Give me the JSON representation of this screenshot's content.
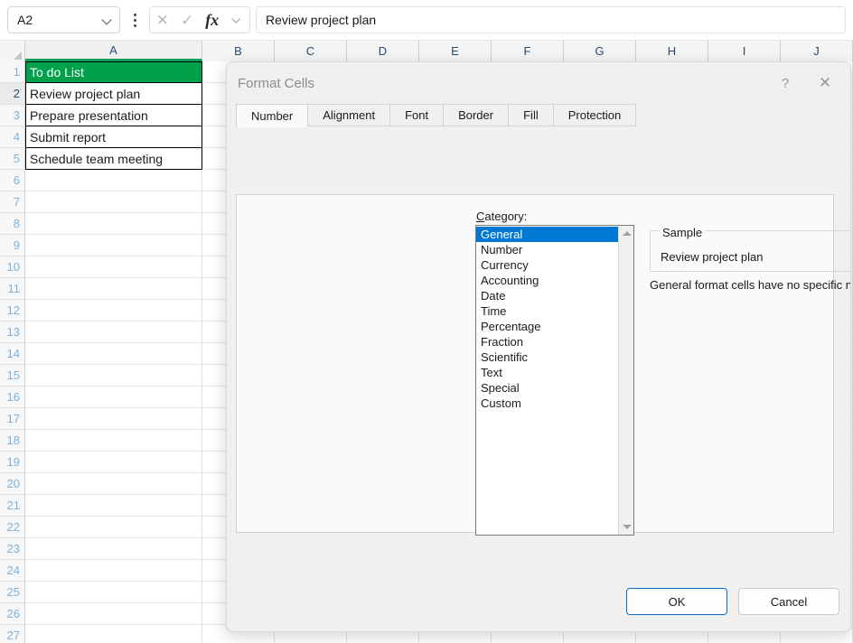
{
  "formula_bar": {
    "name_box_value": "A2",
    "name_box_icon": "chevron-down-icon",
    "menu_icon": "kebab-menu-icon",
    "cancel_icon": "✕",
    "confirm_icon": "✓",
    "function_icon": "fx",
    "function_dropdown_icon": "chevron-down-icon",
    "formula_value": "Review project plan"
  },
  "grid": {
    "column_headers": [
      "A",
      "B",
      "C",
      "D",
      "E",
      "F",
      "G",
      "H",
      "I",
      "J"
    ],
    "selected_column": "A",
    "selected_row": 2,
    "row_headers": [
      1,
      2,
      3,
      4,
      5,
      6,
      7,
      8,
      9,
      10,
      11,
      12,
      13,
      14,
      15,
      16,
      17,
      18,
      19,
      20,
      21,
      22,
      23,
      24,
      25,
      26,
      27
    ],
    "cells_column_a": [
      {
        "row": 1,
        "text": "To do List",
        "style": "green-header"
      },
      {
        "row": 2,
        "text": "Review project plan",
        "style": "bordered"
      },
      {
        "row": 3,
        "text": "Prepare presentation",
        "style": "bordered"
      },
      {
        "row": 4,
        "text": "Submit report",
        "style": "bordered"
      },
      {
        "row": 5,
        "text": "Schedule team meeting",
        "style": "bordered"
      }
    ],
    "colors": {
      "header_fill": "#00A14B",
      "header_text": "#FFFFFF",
      "selected_col_underline": "#0F9D58"
    }
  },
  "dialog": {
    "title": "Format Cells",
    "help_label": "?",
    "close_label": "✕",
    "tabs": [
      {
        "label": "Number",
        "active": true
      },
      {
        "label": "Alignment",
        "active": false
      },
      {
        "label": "Font",
        "active": false
      },
      {
        "label": "Border",
        "active": false
      },
      {
        "label": "Fill",
        "active": false
      },
      {
        "label": "Protection",
        "active": false
      }
    ],
    "category_label": "Category:",
    "categories": [
      {
        "label": "General",
        "selected": true
      },
      {
        "label": "Number",
        "selected": false
      },
      {
        "label": "Currency",
        "selected": false
      },
      {
        "label": "Accounting",
        "selected": false
      },
      {
        "label": "Date",
        "selected": false
      },
      {
        "label": "Time",
        "selected": false
      },
      {
        "label": "Percentage",
        "selected": false
      },
      {
        "label": "Fraction",
        "selected": false
      },
      {
        "label": "Scientific",
        "selected": false
      },
      {
        "label": "Text",
        "selected": false
      },
      {
        "label": "Special",
        "selected": false
      },
      {
        "label": "Custom",
        "selected": false
      }
    ],
    "scroll_up_icon": "triangle-up-icon",
    "scroll_down_icon": "triangle-down-icon",
    "sample_legend": "Sample",
    "sample_value": "Review project plan",
    "description": "General format cells have no specific number format.",
    "ok_label": "OK",
    "cancel_label": "Cancel",
    "accent_color": "#0078D4"
  }
}
